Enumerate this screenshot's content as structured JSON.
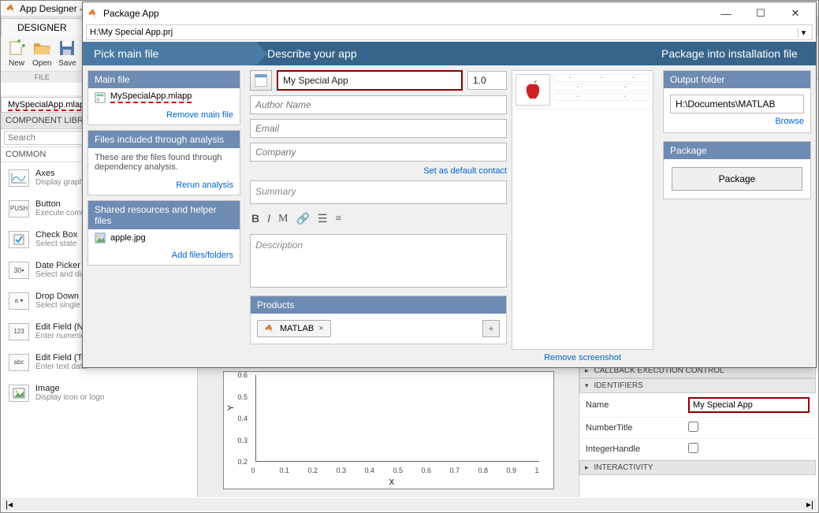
{
  "designer": {
    "app_title": "App Designer - ",
    "tab": "DESIGNER",
    "toolbar": {
      "new": "New",
      "open": "Open",
      "save": "Save",
      "section": "FILE"
    },
    "file_tab": "MySpecialApp.mlapp",
    "comp_lib": "COMPONENT LIBRARY",
    "search_ph": "Search",
    "common": "COMMON",
    "components": [
      {
        "name": "Axes",
        "sub": "Display graphs",
        "icon": "axes"
      },
      {
        "name": "Button",
        "sub": "Execute command",
        "icon": "push"
      },
      {
        "name": "Check Box",
        "sub": "Select state",
        "icon": "check"
      },
      {
        "name": "Date Picker",
        "sub": "Select and display date",
        "icon": "date"
      },
      {
        "name": "Drop Down",
        "sub": "Select single option",
        "icon": "drop"
      },
      {
        "name": "Edit Field (Numeric)",
        "sub": "Enter numeric data",
        "icon": "num"
      },
      {
        "name": "Edit Field (Text)",
        "sub": "Enter text data",
        "icon": "text"
      },
      {
        "name": "Image",
        "sub": "Display icon or logo",
        "icon": "img"
      }
    ],
    "axes_preview": {
      "ylabel": "Y",
      "xlabel": "X",
      "xticks": [
        "0",
        "0.1",
        "0.2",
        "0.3",
        "0.4",
        "0.5",
        "0.6",
        "0.7",
        "0.8",
        "0.9",
        "1"
      ],
      "yticks": [
        "0.2",
        "0.3",
        "0.4",
        "0.5",
        "0.6"
      ]
    },
    "props": {
      "sect1": "CALLBACK EXECUTION CONTROL",
      "sect2": "IDENTIFIERS",
      "sect3": "INTERACTIVITY",
      "name_lab": "Name",
      "name_val": "My Special App",
      "numtitle": "NumberTitle",
      "inthdl": "IntegerHandle"
    }
  },
  "pkg": {
    "title": "Package App",
    "path": "H:\\My Special App.prj",
    "steps": {
      "s1": "Pick main file",
      "s2": "Describe your app",
      "s3": "Package into installation file"
    },
    "mainfile": {
      "hdr": "Main file",
      "fname": "MySpecialApp.mlapp",
      "remove": "Remove main file"
    },
    "analysis": {
      "hdr": "Files included through analysis",
      "txt": "These are the files found through dependency analysis.",
      "rerun": "Rerun analysis"
    },
    "shared": {
      "hdr": "Shared resources and helper files",
      "file": "apple.jpg",
      "add": "Add files/folders"
    },
    "form": {
      "appname": "My Special App",
      "version": "1.0",
      "author_ph": "Author Name",
      "email_ph": "Email",
      "company_ph": "Company",
      "default_contact": "Set as default contact",
      "summary_ph": "Summary",
      "desc_ph": "Description"
    },
    "products": {
      "hdr": "Products",
      "item": "MATLAB"
    },
    "screenshot": {
      "remove": "Remove screenshot"
    },
    "output": {
      "hdr": "Output folder",
      "path": "H:\\Documents\\MATLAB",
      "browse": "Browse"
    },
    "package": {
      "hdr": "Package",
      "btn": "Package"
    }
  }
}
